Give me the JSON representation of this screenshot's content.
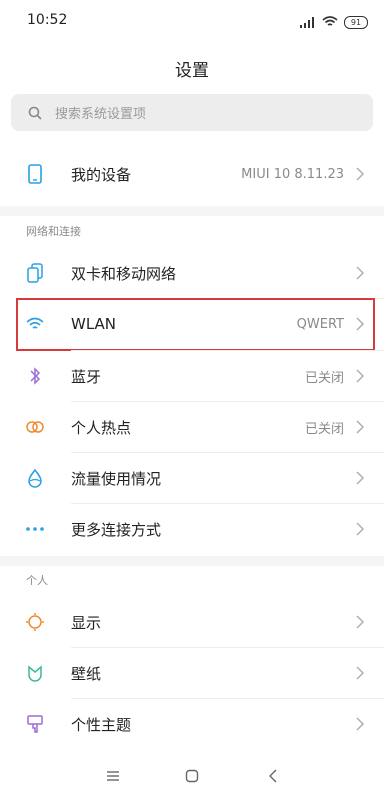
{
  "status": {
    "time": "10:52",
    "battery": "91"
  },
  "title": "设置",
  "search": {
    "placeholder": "搜索系统设置项"
  },
  "device": {
    "label": "我的设备",
    "value": "MIUI 10 8.11.23"
  },
  "sections": {
    "network": "网络和连接",
    "personal": "个人"
  },
  "items": {
    "dualsim": {
      "label": "双卡和移动网络"
    },
    "wlan": {
      "label": "WLAN",
      "value": "QWERT"
    },
    "bluetooth": {
      "label": "蓝牙",
      "value": "已关闭"
    },
    "hotspot": {
      "label": "个人热点",
      "value": "已关闭"
    },
    "datausage": {
      "label": "流量使用情况"
    },
    "more": {
      "label": "更多连接方式"
    },
    "display": {
      "label": "显示"
    },
    "wallpaper": {
      "label": "壁纸"
    },
    "theme": {
      "label": "个性主题"
    }
  },
  "colors": {
    "accent": "#2aa0e6",
    "highlight": "#d53b3b"
  }
}
